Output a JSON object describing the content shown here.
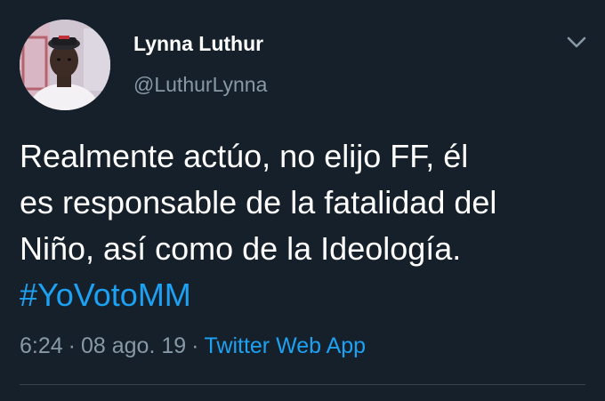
{
  "colors": {
    "background": "#15202b",
    "primary_text": "#ffffff",
    "secondary_text": "#8899a6",
    "link": "#1da1f2",
    "divider": "#38444d"
  },
  "author": {
    "display_name": "Lynna Luthur",
    "handle": "@LuthurLynna",
    "avatar_icon": "profile-photo"
  },
  "menu": {
    "icon": "chevron-down-icon"
  },
  "tweet": {
    "text_lines": [
      "Realmente actúo, no elijo FF, él",
      "es responsable de la fatalidad del",
      "Niño, así como de la Ideología."
    ],
    "hashtag": "#YoVotoMM"
  },
  "meta": {
    "time": "6:24",
    "separator": "·",
    "date": "08 ago. 19",
    "source": "Twitter Web App"
  }
}
